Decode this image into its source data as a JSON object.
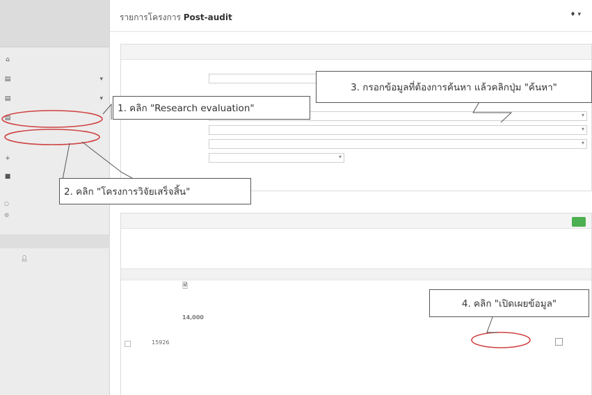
{
  "topbar": {
    "title_prefix": "รายการโครงการ",
    "title_bold": "Post-audit"
  },
  "tbl": {
    "row": {
      "id": "15926",
      "amount": "14,000"
    }
  },
  "annotations": {
    "step1": "1. คลิก \"Research evaluation\"",
    "step2": "2. คลิก \"โครงการวิจัยเสร็จสิ้น\"",
    "step3": "3. กรอกข้อมูลที่ต้องการค้นหา แล้วคลิกปุ่ม \"ค้นหา\"",
    "step4": "4. คลิก \"เปิดเผยข้อมูล\""
  },
  "colors": {
    "annotation_red": "#d04040",
    "add_button_green": "#4caf50"
  }
}
